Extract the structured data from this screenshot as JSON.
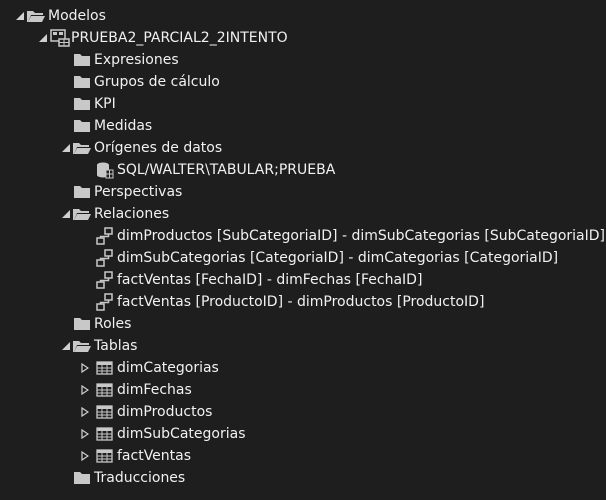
{
  "tree": {
    "root": {
      "label": "Modelos",
      "icon": "folder-open-icon",
      "expanded": true
    },
    "model": {
      "label": "PRUEBA2_PARCIAL2_2INTENTO",
      "icon": "tabular-model-icon",
      "expanded": true
    },
    "expresiones": {
      "label": "Expresiones",
      "icon": "folder-icon"
    },
    "grupos": {
      "label": "Grupos de cálculo",
      "icon": "folder-icon"
    },
    "kpi": {
      "label": "KPI",
      "icon": "folder-icon"
    },
    "medidas": {
      "label": "Medidas",
      "icon": "folder-icon"
    },
    "origenes": {
      "label": "Orígenes de datos",
      "icon": "folder-open-icon",
      "expanded": true,
      "items": [
        {
          "label": "SQL/WALTER\\TABULAR;PRUEBA",
          "icon": "database-icon"
        }
      ]
    },
    "perspectivas": {
      "label": "Perspectivas",
      "icon": "folder-icon"
    },
    "relaciones": {
      "label": "Relaciones",
      "icon": "folder-open-icon",
      "expanded": true,
      "items": [
        {
          "label": "dimProductos [SubCategoriaID] - dimSubCategorias [SubCategoriaID]",
          "icon": "relationship-icon"
        },
        {
          "label": "dimSubCategorias [CategoriaID] - dimCategorias [CategoriaID]",
          "icon": "relationship-icon"
        },
        {
          "label": "factVentas [FechaID] - dimFechas [FechaID]",
          "icon": "relationship-icon"
        },
        {
          "label": "factVentas [ProductoID] - dimProductos [ProductoID]",
          "icon": "relationship-icon"
        }
      ]
    },
    "roles": {
      "label": "Roles",
      "icon": "folder-icon"
    },
    "tablas": {
      "label": "Tablas",
      "icon": "folder-open-icon",
      "expanded": true,
      "items": [
        {
          "label": "dimCategorias",
          "icon": "table-icon",
          "expanded": false
        },
        {
          "label": "dimFechas",
          "icon": "table-icon",
          "expanded": false
        },
        {
          "label": "dimProductos",
          "icon": "table-icon",
          "expanded": false
        },
        {
          "label": "dimSubCategorias",
          "icon": "table-icon",
          "expanded": false
        },
        {
          "label": "factVentas",
          "icon": "table-icon",
          "expanded": false
        }
      ]
    },
    "traducciones": {
      "label": "Traducciones",
      "icon": "folder-icon"
    }
  },
  "colors": {
    "background": "#1e1e1e",
    "text": "#f1f1f1",
    "icon": "#c8c8c8",
    "glyph": "#d0d0d0"
  }
}
